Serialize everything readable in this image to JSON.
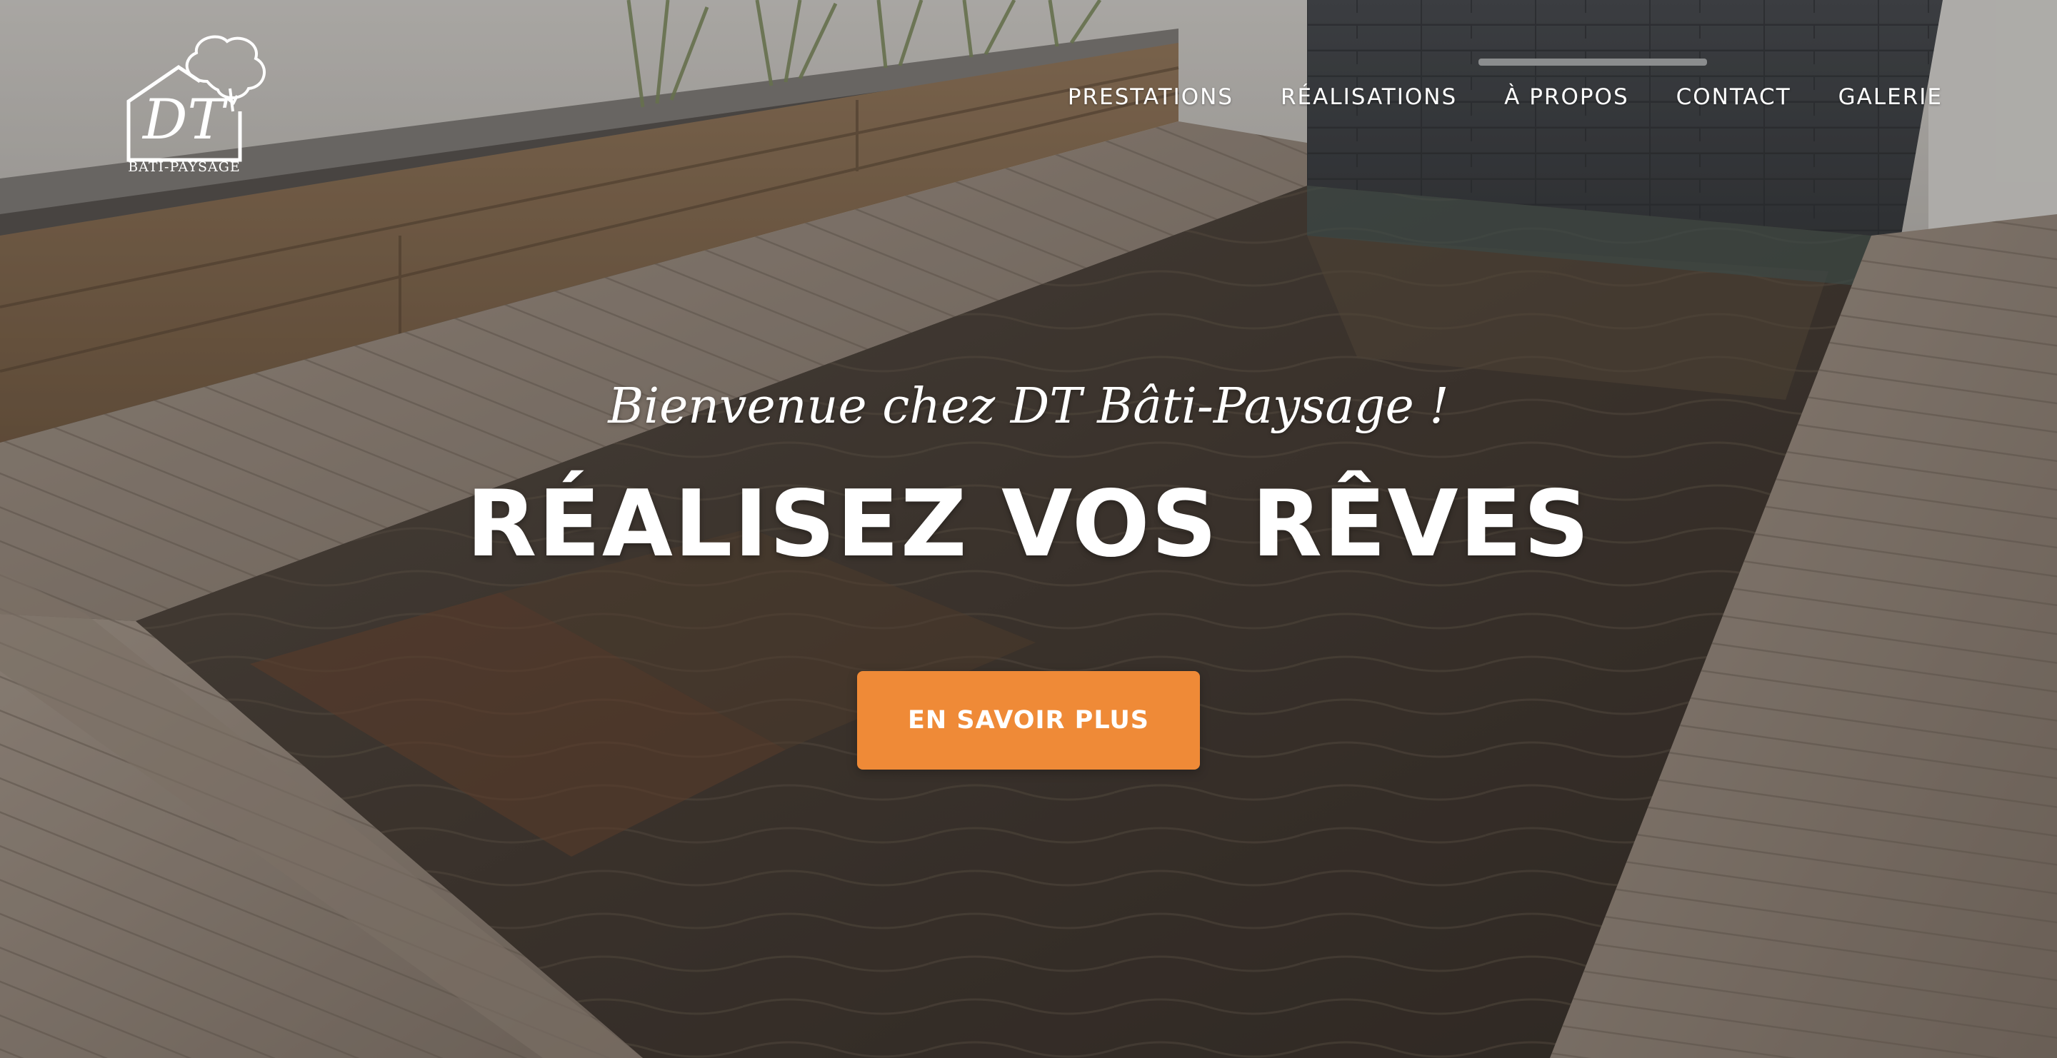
{
  "brand": {
    "logo_monogram": "DT",
    "logo_name": "BÂTI-PAYSAGE"
  },
  "nav": {
    "items": [
      {
        "label": "PRESTATIONS"
      },
      {
        "label": "RÉALISATIONS"
      },
      {
        "label": "À PROPOS"
      },
      {
        "label": "CONTACT"
      },
      {
        "label": "GALERIE"
      }
    ]
  },
  "hero": {
    "subtitle": "Bienvenue chez DT Bâti-Paysage !",
    "title": "RÉALISEZ VOS RÊVES",
    "cta_label": "EN SAVOIR PLUS"
  },
  "colors": {
    "accent": "#ef8a37",
    "text": "#ffffff"
  },
  "icons": {
    "logo": "house-tree-logo-icon"
  }
}
